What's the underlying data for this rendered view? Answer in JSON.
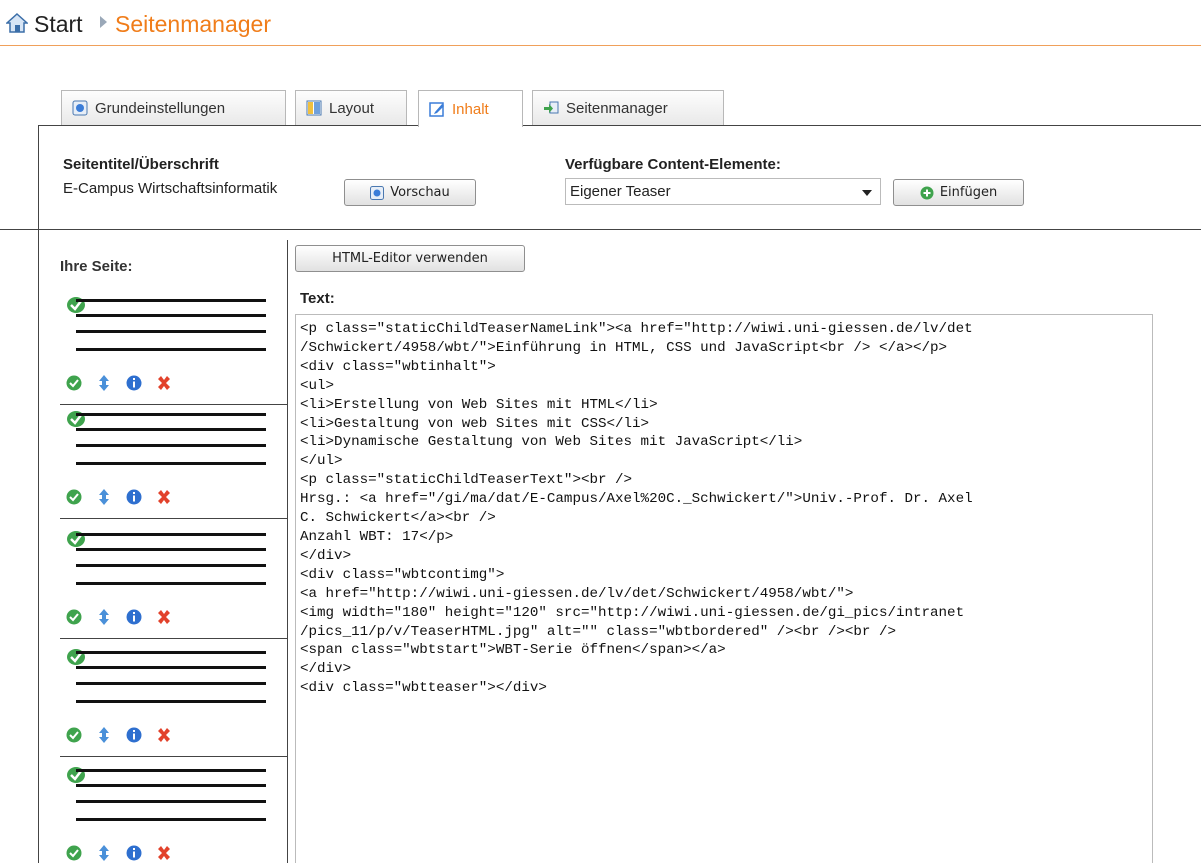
{
  "breadcrumb": {
    "start": "Start",
    "current": "Seitenmanager",
    "home_icon": "home-icon",
    "accent_color": "#f07d1a"
  },
  "tabs": [
    {
      "label": "Grundeinstellungen",
      "icon": "settings-page-icon",
      "active": false
    },
    {
      "label": "Layout",
      "icon": "layout-icon",
      "active": false
    },
    {
      "label": "Inhalt",
      "icon": "edit-icon",
      "active": true
    },
    {
      "label": "Seitenmanager",
      "icon": "page-manager-icon",
      "active": false
    }
  ],
  "settings": {
    "title_label": "Seitentitel/Überschrift",
    "title_value": "E-Campus Wirtschaftsinformatik",
    "preview_button": "Vorschau",
    "content_elements_label": "Verfügbare Content-Elemente:",
    "content_elements_selected": "Eigener Teaser",
    "insert_button": "Einfügen"
  },
  "sidebar": {
    "title": "Ihre Seite:",
    "blocks": [
      {
        "actions": [
          "check-icon",
          "move-icon",
          "info-icon",
          "delete-icon"
        ]
      },
      {
        "actions": [
          "check-icon",
          "move-icon",
          "info-icon",
          "delete-icon"
        ]
      },
      {
        "actions": [
          "check-icon",
          "move-icon",
          "info-icon",
          "delete-icon"
        ]
      },
      {
        "actions": [
          "check-icon",
          "move-icon",
          "info-icon",
          "delete-icon"
        ]
      },
      {
        "actions": [
          "check-icon",
          "move-icon",
          "info-icon",
          "delete-icon"
        ]
      }
    ]
  },
  "editor": {
    "html_editor_button": "HTML-Editor verwenden",
    "text_label": "Text:",
    "lines": [
      "<p class=\"staticChildTeaserNameLink\"><a href=\"http://wiwi.uni-giessen.de/lv/det",
      "/Schwickert/4958/wbt/\">Einführung in HTML, CSS und JavaScript<br /> </a></p>",
      "<div class=\"wbtinhalt\">",
      "<ul>",
      "<li>Erstellung von Web Sites mit HTML</li>",
      "<li>Gestaltung von web Sites mit CSS</li>",
      "<li>Dynamische Gestaltung von Web Sites mit JavaScript</li>",
      "</ul>",
      "<p class=\"staticChildTeaserText\"><br />",
      "Hrsg.: <a href=\"/gi/ma/dat/E-Campus/Axel%20C._Schwickert/\">Univ.-Prof. Dr. Axel",
      "C. Schwickert</a><br />",
      "Anzahl WBT: 17</p>",
      "</div>",
      "<div class=\"wbtcontimg\">",
      "<a href=\"http://wiwi.uni-giessen.de/lv/det/Schwickert/4958/wbt/\">",
      "<img width=\"180\" height=\"120\" src=\"http://wiwi.uni-giessen.de/gi_pics/intranet",
      "/pics_11/p/v/TeaserHTML.jpg\" alt=\"\" class=\"wbtbordered\" /><br /><br />",
      "<span class=\"wbtstart\">WBT-Serie öffnen</span></a>",
      "</div>",
      "<div class=\"wbtteaser\"></div>"
    ]
  }
}
